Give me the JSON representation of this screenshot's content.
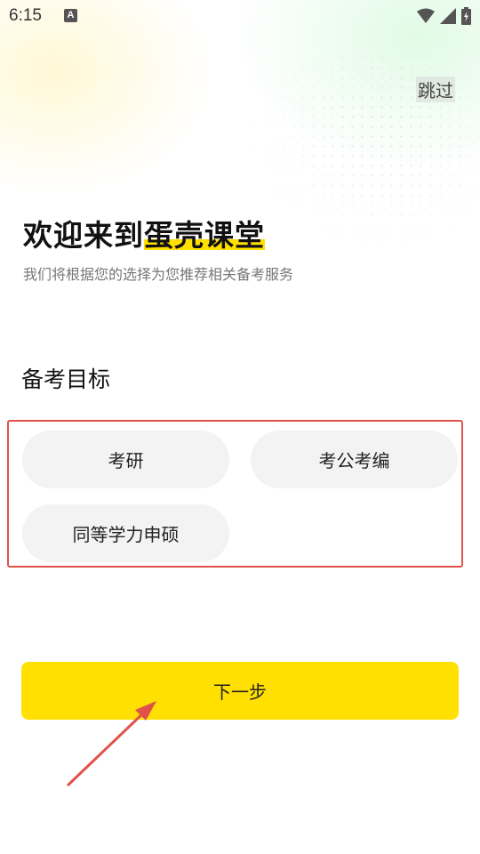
{
  "status_bar": {
    "time": "6:15",
    "notification_icon_letter": "A",
    "icons": [
      "wifi-icon",
      "cell-signal-icon",
      "battery-icon"
    ]
  },
  "header": {
    "skip_label": "跳过"
  },
  "welcome": {
    "title_prefix": "欢迎来到",
    "title_highlight": "蛋壳课堂",
    "subtitle": "我们将根据您的选择为您推荐相关备考服务"
  },
  "goal_section": {
    "title": "备考目标",
    "options": [
      {
        "label": "考研"
      },
      {
        "label": "考公考编"
      },
      {
        "label": "同等学力申硕"
      }
    ]
  },
  "footer": {
    "next_label": "下一步"
  },
  "colors": {
    "accent": "#ffe000",
    "annotation_red": "#e0524a",
    "option_bg": "#f3f3f3"
  }
}
